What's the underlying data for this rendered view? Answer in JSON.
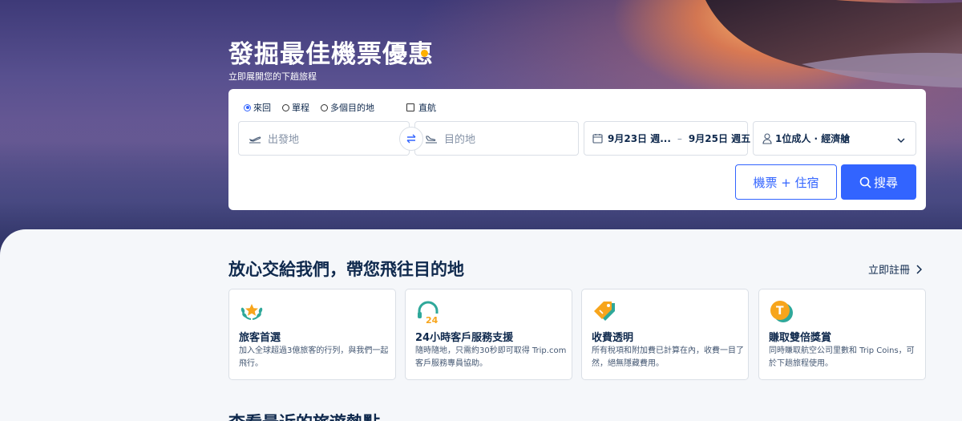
{
  "hero": {
    "title": "發掘最佳機票優惠",
    "subtitle": "立即展開您的下趟旅程"
  },
  "search": {
    "trip_types": [
      {
        "label": "來回",
        "selected": true
      },
      {
        "label": "單程",
        "selected": false
      },
      {
        "label": "多個目的地",
        "selected": false
      }
    ],
    "direct_label": "直航",
    "direct_checked": false,
    "origin_placeholder": "出發地",
    "destination_placeholder": "目的地",
    "depart_date": "9月23日 週...",
    "return_date": "9月25日 週五",
    "date_separator": "–",
    "passengers": "1位成人 · 經濟艙",
    "bundle_button": "機票 + 住宿",
    "search_button": "搜尋",
    "accent_color": "#3264ff"
  },
  "trust": {
    "title": "放心交給我們，帶您飛往目的地",
    "register_link": "立即註冊",
    "cards": [
      {
        "icon": "laurel-star-icon",
        "title": "旅客首選",
        "desc": "加入全球超過3億旅客的行列，與我們一起飛行。"
      },
      {
        "icon": "headset-24-icon",
        "title": "24小時客戶服務支援",
        "desc": "隨時隨地，只需約30秒即可取得 Trip.com 客戶服務專員協助。"
      },
      {
        "icon": "price-tag-icon",
        "title": "收費透明",
        "desc": "所有稅項和附加費已計算在內，收費一目了然，絕無隱藏費用。"
      },
      {
        "icon": "trip-coin-icon",
        "title": "賺取雙倍獎賞",
        "desc": "同時賺取航空公司里數和 Trip Coins，可於下趟旅程使用。"
      }
    ]
  },
  "recent": {
    "title": "查看最近的旅遊熱點"
  }
}
